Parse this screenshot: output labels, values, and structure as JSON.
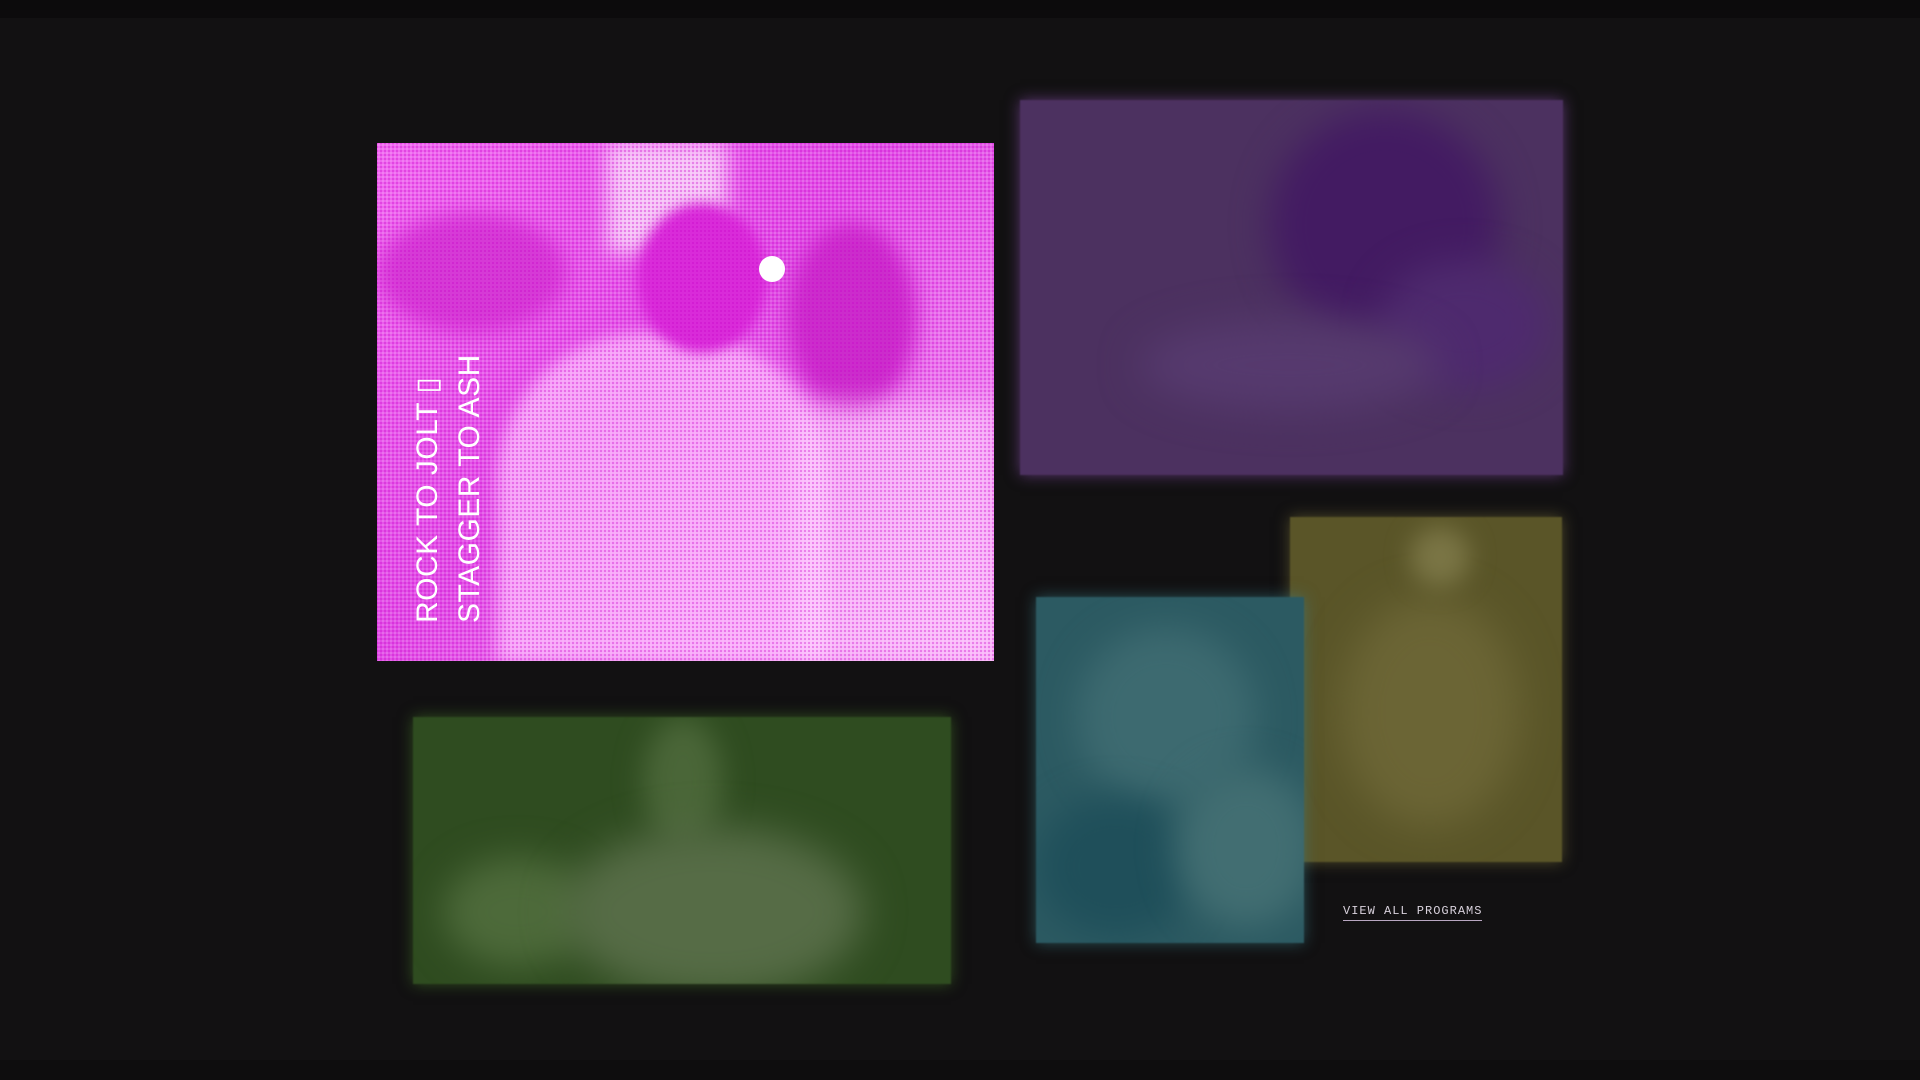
{
  "featured": {
    "title_line1": "ROCK TO JOLT ▯",
    "title_line2": "STAGGER TO ASH"
  },
  "programs": [
    {
      "name": "program-card-purple",
      "color": "#4c3160"
    },
    {
      "name": "program-card-teal",
      "color": "#2c5a62"
    },
    {
      "name": "program-card-olive",
      "color": "#5a5528"
    },
    {
      "name": "program-card-green",
      "color": "#2f4c20"
    }
  ],
  "featured_color": "#e14de6",
  "view_all_label": "VIEW ALL PROGRAMS"
}
